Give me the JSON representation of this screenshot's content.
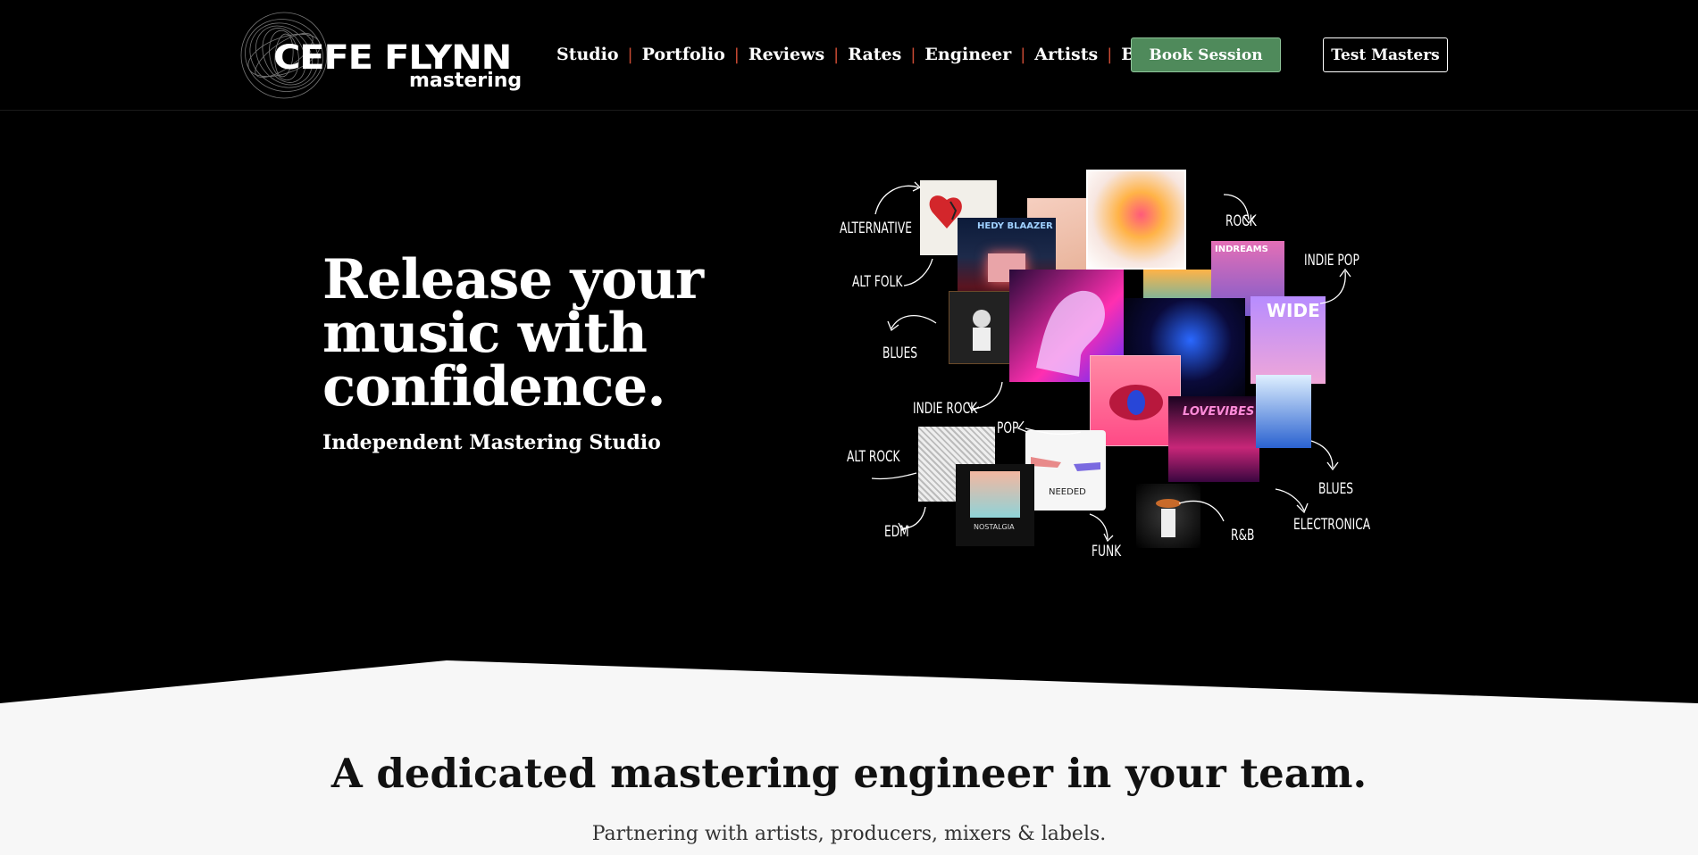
{
  "header": {
    "logo_name": "CEFE FLYNN",
    "logo_sub": "mastering",
    "nav": [
      "Studio",
      "Portfolio",
      "Reviews",
      "Rates",
      "Engineer",
      "Artists",
      "Blog"
    ],
    "separator": "|",
    "book_label": "Book Session",
    "test_label": "Test Masters"
  },
  "hero": {
    "title_line1": "Release your",
    "title_line2": "music with",
    "title_line3": "confidence.",
    "subtitle": "Independent Mastering Studio",
    "genres": [
      "ALTERNATIVE",
      "ALT FOLK",
      "BLUES",
      "INDIE ROCK",
      "POP",
      "ALT ROCK",
      "EDM",
      "FUNK",
      "R&B",
      "ELECTRONICA",
      "BLUES",
      "INDIE POP",
      "ROCK"
    ],
    "covers": [
      "HEDY BLAAZER",
      "INDREAMS",
      "WIDE",
      "LOVEVIBES",
      "NEEDED",
      "NOSTALGIA"
    ]
  },
  "section": {
    "title": "A dedicated mastering engineer in your team.",
    "subtitle": "Partnering with artists, producers, mixers & labels."
  },
  "colors": {
    "accent_green": "#4f8a5b",
    "separator_red": "#c94a33",
    "light_bg": "#f7f7f7"
  }
}
